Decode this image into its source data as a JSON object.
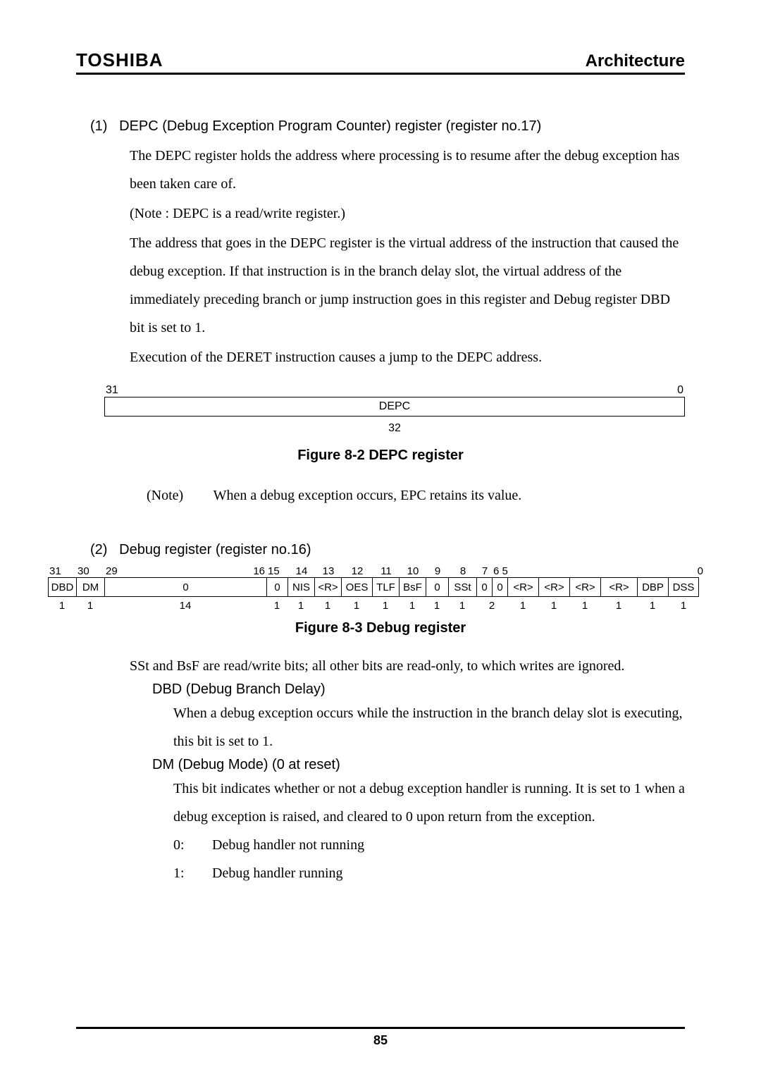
{
  "header": {
    "brand": "TOSHIBA",
    "section": "Architecture"
  },
  "s1": {
    "num": "(1)",
    "title": "DEPC (Debug Exception Program Counter) register (register no.17)",
    "p1": "The DEPC register holds the address where processing is to resume after the debug exception has been taken care of.",
    "note": "(Note :    DEPC is a read/write register.)",
    "p2": "The address that goes in the DEPC register is the virtual address of the instruction that caused the debug exception.    If that instruction is in the branch delay slot, the virtual address of the immediately preceding branch or jump instruction goes in this register and Debug register DBD bit is set to 1.",
    "p3": "Execution of the DERET instruction causes a jump to the DEPC address."
  },
  "depc": {
    "hi": "31",
    "lo": "0",
    "label": "DEPC",
    "width": "32",
    "caption": "Figure 8-2   DEPC register"
  },
  "midnote": {
    "label": "(Note)",
    "text": "When a debug exception occurs, EPC retains its value."
  },
  "s2": {
    "num": "(2)",
    "title": "Debug register (register no.16)"
  },
  "dbg": {
    "bits": [
      "31",
      "30",
      "29",
      "",
      "16",
      "15",
      "14",
      "13",
      "12",
      "11",
      "10",
      "9",
      "8",
      "7",
      "6 5",
      "",
      "",
      "",
      "",
      "",
      ""
    ],
    "fields": [
      "DBD",
      "DM",
      "0",
      "0",
      "NIS",
      "<R>",
      "OES",
      "TLF",
      "BsF",
      "0",
      "SSt",
      "0",
      "0",
      "<R>",
      "<R>",
      "<R>",
      "<R>",
      "DBP",
      "DSS"
    ],
    "widths": [
      "1",
      "1",
      "14",
      "1",
      "1",
      "1",
      "1",
      "1",
      "1",
      "1",
      "1",
      "2",
      "1",
      "1",
      "1",
      "1",
      "1",
      "1"
    ],
    "caption": "Figure 8-3   Debug register"
  },
  "after": {
    "rw": "SSt and BsF are read/write bits; all other bits are read-only, to which writes are ignored.",
    "dbd_head": "DBD (Debug Branch Delay)",
    "dbd_body": "When a debug exception occurs while the instruction in the branch delay slot is executing, this bit is set to 1.",
    "dm_head": "DM (Debug Mode) (0 at reset)",
    "dm_body": "This bit indicates whether or not a debug exception handler is running.    It is set to 1 when a debug exception is raised, and cleared to 0 upon return from the exception.",
    "l0n": "0:",
    "l0t": "Debug handler not running",
    "l1n": "1:",
    "l1t": "Debug handler running"
  },
  "footer": {
    "page": "85"
  },
  "chart_data": [
    {
      "type": "table",
      "title": "DEPC register layout",
      "bit_hi": 31,
      "bit_lo": 0,
      "fields": [
        {
          "name": "DEPC",
          "bits": "31:0",
          "width": 32
        }
      ]
    },
    {
      "type": "table",
      "title": "Debug register layout",
      "bit_hi": 31,
      "bit_lo": 0,
      "fields": [
        {
          "name": "DBD",
          "bits": "31",
          "width": 1
        },
        {
          "name": "DM",
          "bits": "30",
          "width": 1
        },
        {
          "name": "0",
          "bits": "29:16",
          "width": 14
        },
        {
          "name": "0",
          "bits": "15",
          "width": 1
        },
        {
          "name": "NIS",
          "bits": "14",
          "width": 1
        },
        {
          "name": "<R>",
          "bits": "13",
          "width": 1
        },
        {
          "name": "OES",
          "bits": "12",
          "width": 1
        },
        {
          "name": "TLF",
          "bits": "11",
          "width": 1
        },
        {
          "name": "BsF",
          "bits": "10",
          "width": 1
        },
        {
          "name": "0",
          "bits": "9",
          "width": 1
        },
        {
          "name": "SSt",
          "bits": "8",
          "width": 1
        },
        {
          "name": "0",
          "bits": "7",
          "width": 1
        },
        {
          "name": "0",
          "bits": "6",
          "width": 1
        },
        {
          "name": "<R>",
          "bits": "5",
          "width": 1
        },
        {
          "name": "<R>",
          "bits": "4",
          "width": 1
        },
        {
          "name": "<R>",
          "bits": "3",
          "width": 1
        },
        {
          "name": "<R>",
          "bits": "2",
          "width": 1
        },
        {
          "name": "DBP",
          "bits": "1",
          "width": 1
        },
        {
          "name": "DSS",
          "bits": "0",
          "width": 1
        }
      ]
    }
  ]
}
